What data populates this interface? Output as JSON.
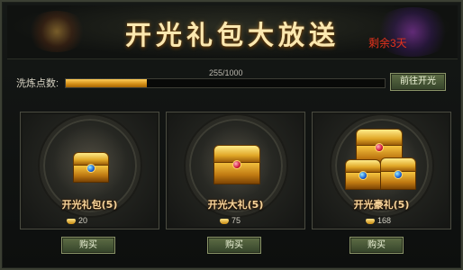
{
  "header": {
    "title": "开光礼包大放送",
    "days_remaining": "剩余3天"
  },
  "progress": {
    "label": "洗炼点数:",
    "value_text": "255/1000",
    "fraction": 0.255
  },
  "goto_button": {
    "label": "前往开光"
  },
  "packages": [
    {
      "name": "开光礼包(5)",
      "price": "20",
      "buy_label": "购买",
      "chest": "single-blue"
    },
    {
      "name": "开光大礼(5)",
      "price": "75",
      "buy_label": "购买",
      "chest": "single-red"
    },
    {
      "name": "开光豪礼(5)",
      "price": "168",
      "buy_label": "购买",
      "chest": "triple"
    }
  ],
  "colors": {
    "title": "#fbe8b0",
    "days": "#e6321c",
    "progress_fill": "#d28c15",
    "button": "#4a5a35"
  }
}
